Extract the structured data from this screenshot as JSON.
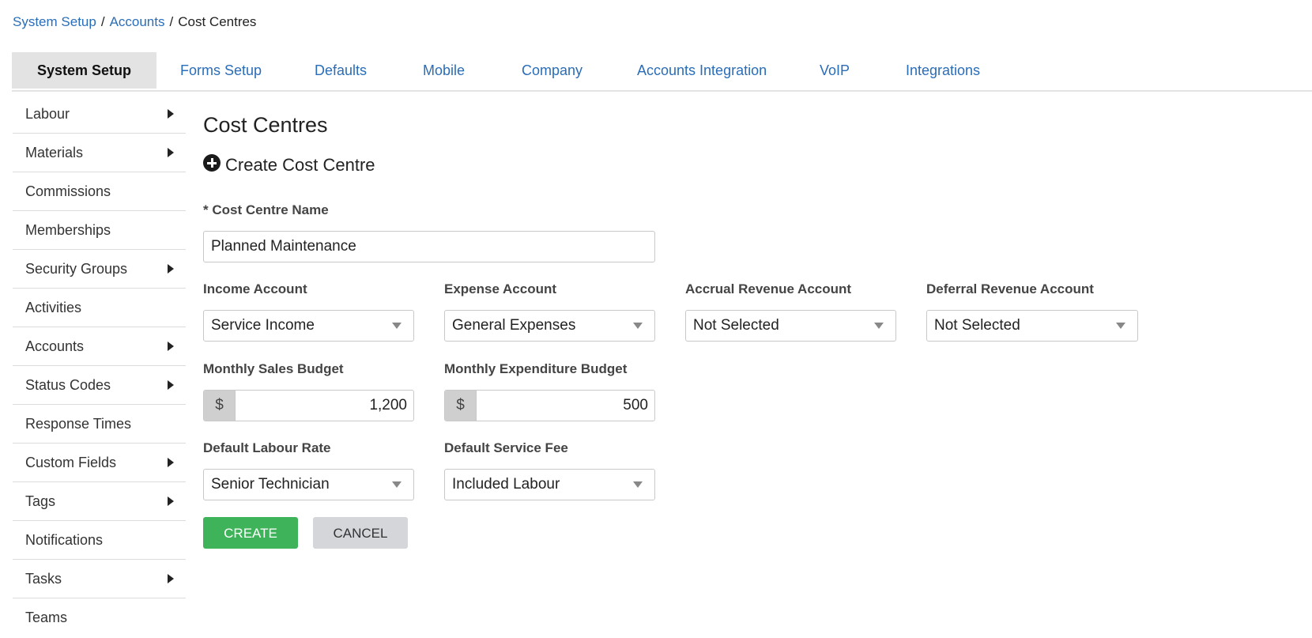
{
  "breadcrumb": {
    "items": [
      "System Setup",
      "Accounts"
    ],
    "current": "Cost Centres",
    "separator": "/"
  },
  "tabs": [
    {
      "label": "System Setup",
      "active": true
    },
    {
      "label": "Forms Setup"
    },
    {
      "label": "Defaults"
    },
    {
      "label": "Mobile"
    },
    {
      "label": "Company"
    },
    {
      "label": "Accounts Integration"
    },
    {
      "label": "VoIP"
    },
    {
      "label": "Integrations"
    }
  ],
  "sidebar": {
    "items": [
      {
        "label": "Labour",
        "has_submenu": true
      },
      {
        "label": "Materials",
        "has_submenu": true
      },
      {
        "label": "Commissions",
        "has_submenu": false
      },
      {
        "label": "Memberships",
        "has_submenu": false
      },
      {
        "label": "Security Groups",
        "has_submenu": true
      },
      {
        "label": "Activities",
        "has_submenu": false
      },
      {
        "label": "Accounts",
        "has_submenu": true
      },
      {
        "label": "Status Codes",
        "has_submenu": true
      },
      {
        "label": "Response Times",
        "has_submenu": false
      },
      {
        "label": "Custom Fields",
        "has_submenu": true
      },
      {
        "label": "Tags",
        "has_submenu": true
      },
      {
        "label": "Notifications",
        "has_submenu": false
      },
      {
        "label": "Tasks",
        "has_submenu": true
      },
      {
        "label": "Teams",
        "has_submenu": false
      }
    ]
  },
  "main": {
    "title": "Cost Centres",
    "create_heading": "Create Cost Centre",
    "form": {
      "name_label": "* Cost Centre Name",
      "name_value": "Planned Maintenance",
      "income_account_label": "Income Account",
      "income_account_value": "Service Income",
      "expense_account_label": "Expense Account",
      "expense_account_value": "General Expenses",
      "accrual_label": "Accrual Revenue Account",
      "accrual_value": "Not Selected",
      "deferral_label": "Deferral Revenue Account",
      "deferral_value": "Not Selected",
      "sales_budget_label": "Monthly Sales Budget",
      "sales_budget_currency": "$",
      "sales_budget_value": "1,200",
      "expenditure_budget_label": "Monthly Expenditure Budget",
      "expenditure_budget_currency": "$",
      "expenditure_budget_value": "500",
      "labour_rate_label": "Default Labour Rate",
      "labour_rate_value": "Senior Technician",
      "service_fee_label": "Default Service Fee",
      "service_fee_value": "Included Labour"
    },
    "buttons": {
      "create": "CREATE",
      "cancel": "CANCEL"
    }
  },
  "colors": {
    "link": "#2a6db8",
    "create_button": "#3fb35a",
    "cancel_button": "#d4d6d9",
    "active_tab": "#e3e3e3"
  }
}
